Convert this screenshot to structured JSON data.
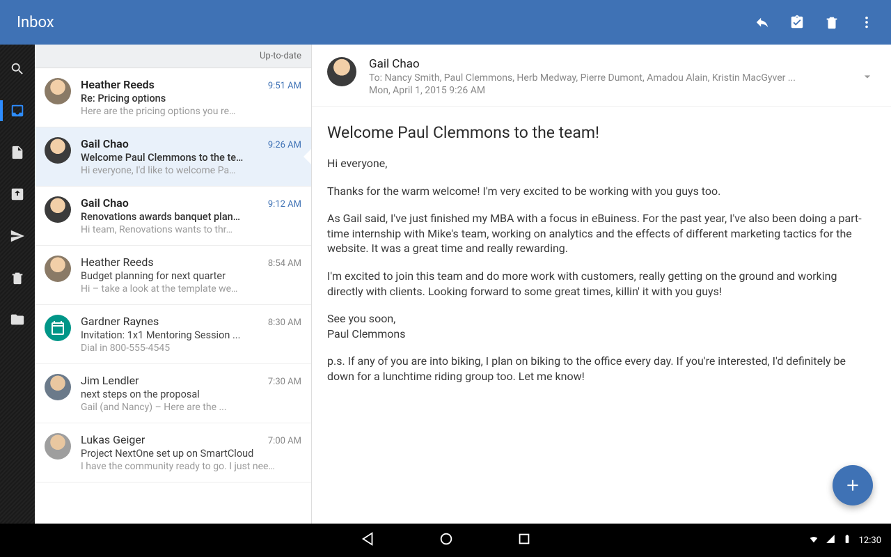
{
  "appbar": {
    "title": "Inbox",
    "actions": {
      "reply": "reply",
      "tasks": "tasks",
      "delete": "delete",
      "overflow": "more"
    }
  },
  "rail": {
    "items": [
      {
        "name": "search",
        "active": false
      },
      {
        "name": "inbox",
        "active": true
      },
      {
        "name": "drafts",
        "active": false
      },
      {
        "name": "outbox",
        "active": false
      },
      {
        "name": "sent",
        "active": false
      },
      {
        "name": "trash",
        "active": false
      },
      {
        "name": "folders",
        "active": false
      }
    ]
  },
  "list": {
    "status": "Up-to-date",
    "messages": [
      {
        "sender": "Heather Reeds",
        "subject": "Re: Pricing options",
        "preview": "Here are the pricing options you re…",
        "time": "9:51 AM",
        "unread": true,
        "selected": false,
        "avatar": "f1"
      },
      {
        "sender": "Gail Chao",
        "subject": "Welcome Paul Clemmons to the te…",
        "preview": "Hi everyone, I'd like to welcome Pa…",
        "time": "9:26 AM",
        "unread": true,
        "selected": true,
        "avatar": "f2"
      },
      {
        "sender": "Gail Chao",
        "subject": "Renovations awards banquet plan…",
        "preview": "Hi team, Renovations wants to thr…",
        "time": "9:12 AM",
        "unread": true,
        "selected": false,
        "avatar": "f2"
      },
      {
        "sender": "Heather Reeds",
        "subject": "Budget planning for next quarter",
        "preview": "Hi – take a look at the template we…",
        "time": "8:54 AM",
        "unread": false,
        "selected": false,
        "avatar": "f1"
      },
      {
        "sender": "Gardner Raynes",
        "subject": "Invitation: 1x1 Mentoring Session ...",
        "preview": "Dial in 800-555-4545",
        "time": "8:30 AM",
        "unread": false,
        "selected": false,
        "avatar": "cal"
      },
      {
        "sender": "Jim Lendler",
        "subject": "next steps on the proposal",
        "preview": "Gail (and Nancy) – Here are the ...",
        "time": "7:30 AM",
        "unread": false,
        "selected": false,
        "avatar": "f3"
      },
      {
        "sender": "Lukas Geiger",
        "subject": "Project NextOne set up on SmartCloud",
        "preview": "I have the community ready to go. I just nee…",
        "time": "7:00 AM",
        "unread": false,
        "selected": false,
        "avatar": "f4"
      }
    ]
  },
  "pane": {
    "from": "Gail Chao",
    "to": "To: Nancy Smith, Paul Clemmons, Herb Medway, Pierre Dumont, Amadou Alain, Kristin MacGyver ...",
    "date": "Mon, April 1, 2015 9:26 AM",
    "subject": "Welcome Paul Clemmons to the team!",
    "paragraphs": [
      "Hi everyone,",
      "Thanks for the warm welcome! I'm very excited to be working with you guys too.",
      "As Gail said, I've just finished my MBA with a focus in eBuiness. For the past year, I've also been doing a part-time internship with Mike's team, working on analytics and the effects of different marketing tactics for the website. It was a great time and really rewarding.",
      "I'm excited to join this team and do more work with customers, really getting on the ground and working directly with clients. Looking forward to some great times, killin' it with you guys!",
      "See you soon,\nPaul Clemmons",
      "p.s. If any of you are into biking, I plan on biking to the office every day. If you're interested, I'd definitely be down for a lunchtime riding group too. Let me know!"
    ]
  },
  "fab": {
    "label": "Compose"
  },
  "navbar": {
    "time": "12:30"
  }
}
